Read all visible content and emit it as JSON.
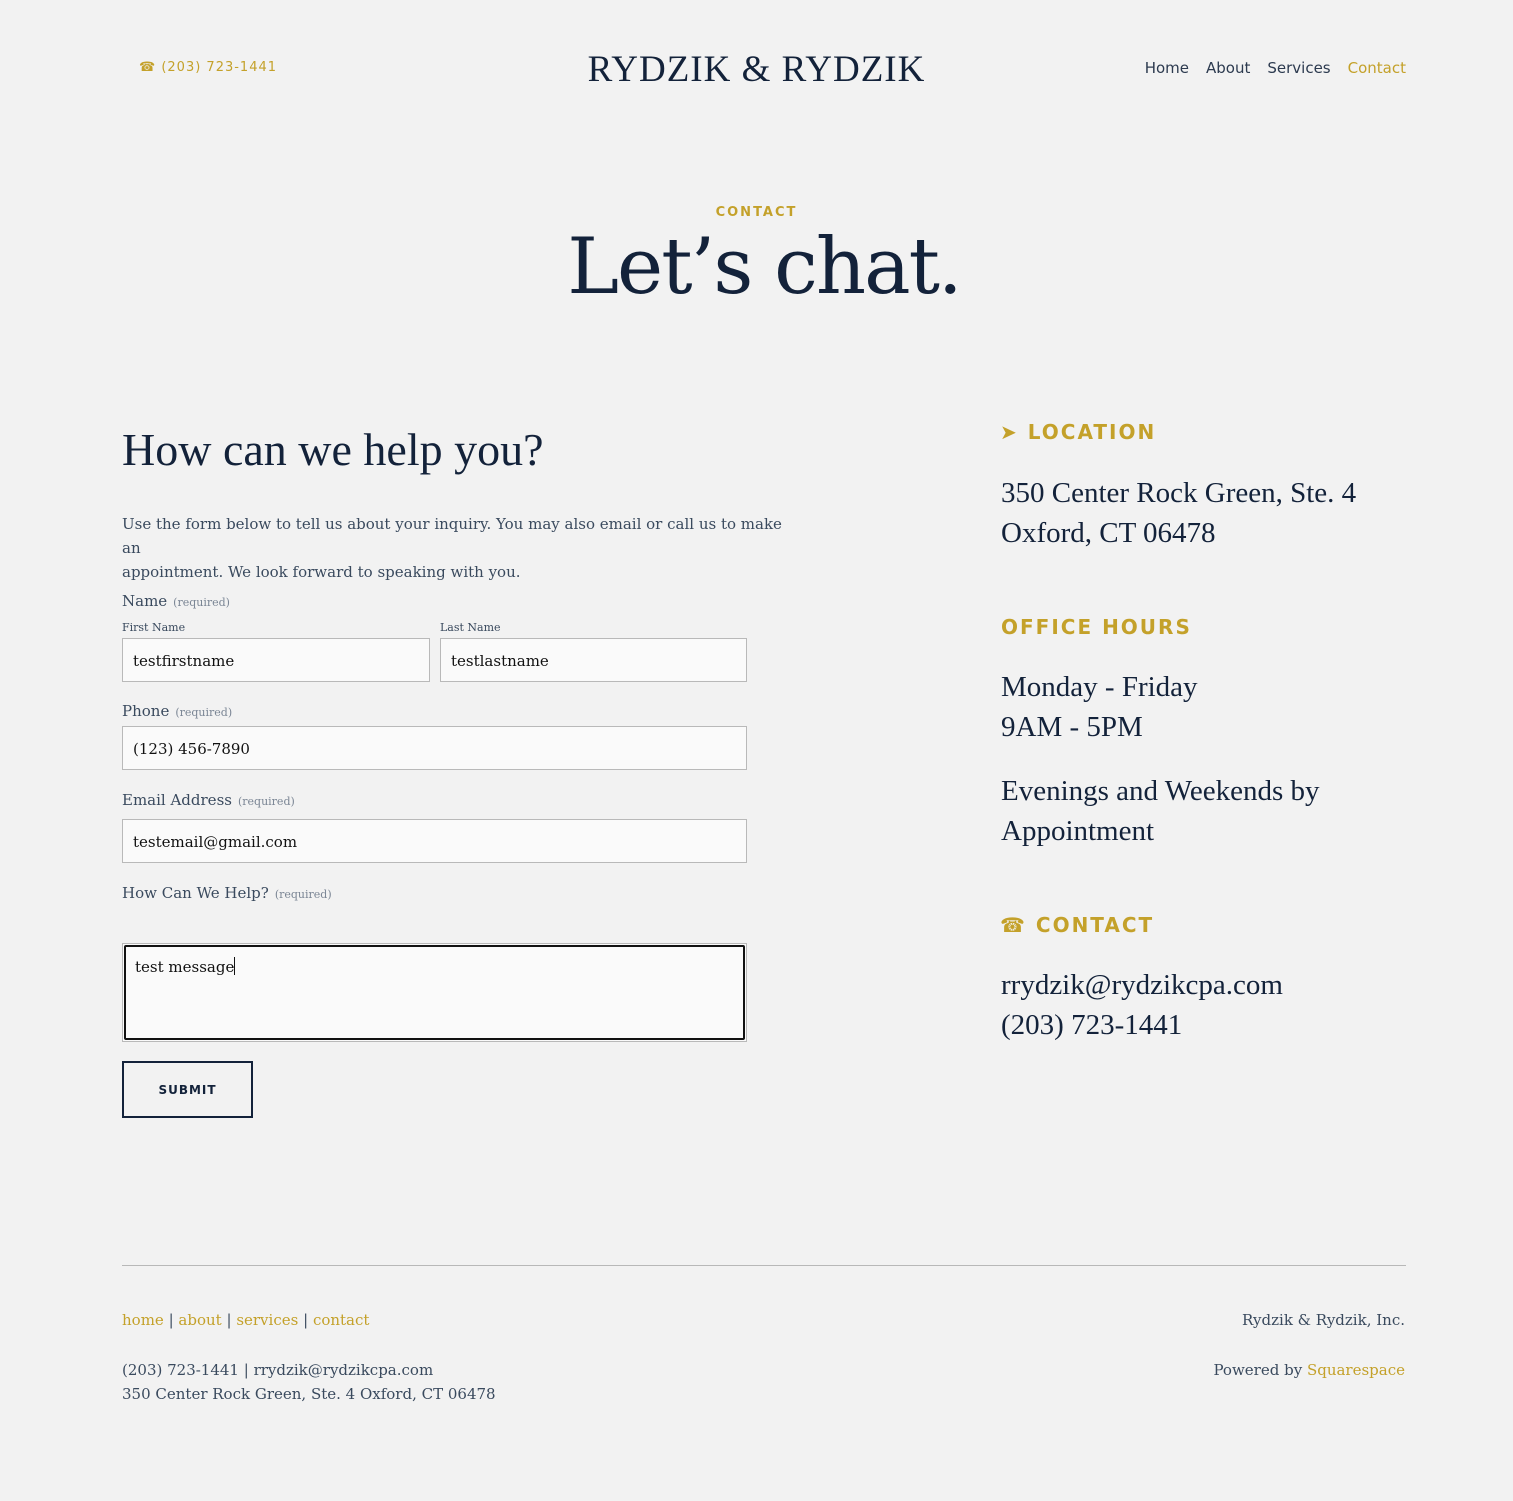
{
  "header": {
    "phone_icon": "☎",
    "phone": "(203) 723-1441",
    "logo": "RYDZIK & RYDZIK",
    "nav": [
      "Home",
      "About",
      "Services",
      "Contact"
    ],
    "active_nav": "Contact"
  },
  "hero": {
    "kicker": "CONTACT",
    "title": "Let’s chat."
  },
  "form": {
    "heading": "How can we help you?",
    "intro_line1": "Use the form below to tell us about your inquiry.  You may also email or call us to make an",
    "intro_line2": "appointment. We look forward to speaking with you.",
    "required": "(required)",
    "name_label": "Name",
    "first_name_label": "First Name",
    "last_name_label": "Last Name",
    "first_name_value": "testfirstname",
    "last_name_value": "testlastname",
    "phone_label": "Phone",
    "phone_value": "(123) 456-7890",
    "email_label": "Email Address",
    "email_value": "testemail@gmail.com",
    "help_label": "How Can We Help?",
    "help_value": "test message",
    "submit_label": "SUBMIT"
  },
  "sidebar": {
    "location_icon": "➤",
    "location_heading": "LOCATION",
    "address_line1": "350 Center Rock Green, Ste. 4",
    "address_line2": "Oxford, CT 06478",
    "hours_heading": "OFFICE HOURS",
    "hours_days": "Monday - Friday",
    "hours_time": "9AM - 5PM",
    "hours_extra_line1": "Evenings and Weekends by",
    "hours_extra_line2": "Appointment",
    "contact_icon": "☎",
    "contact_heading": "CONTACT",
    "email": "rrydzik@rydzikcpa.com",
    "phone": "(203) 723-1441"
  },
  "footer": {
    "links": [
      "home",
      "about",
      "services",
      "contact"
    ],
    "separator": "|",
    "contact_line": "(203) 723-1441 | rrydzik@rydzikcpa.com",
    "address_line": "350 Center Rock Green, Ste. 4 Oxford, CT 06478",
    "company": "Rydzik & Rydzik, Inc.",
    "powered_prefix": "Powered by ",
    "powered_link": "Squarespace"
  },
  "colors": {
    "accent": "#c4a12a",
    "navy": "#13223a",
    "background": "#f2f2f2"
  }
}
